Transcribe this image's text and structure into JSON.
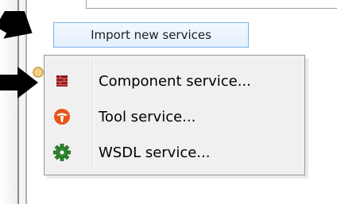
{
  "import_button": {
    "label": "Import new services"
  },
  "menu": {
    "items": [
      {
        "label": "Component service...",
        "icon": "component-icon"
      },
      {
        "label": "Tool service...",
        "icon": "tool-icon"
      },
      {
        "label": "WSDL service...",
        "icon": "wsdl-gear-icon"
      }
    ]
  },
  "colors": {
    "button_border": "#7eb4ea",
    "menu_bg": "#f0f0f0",
    "component_icon": "#8b1a1a",
    "tool_icon": "#e8541a",
    "wsdl_icon": "#2e8b2e",
    "arrow": "#000000"
  }
}
